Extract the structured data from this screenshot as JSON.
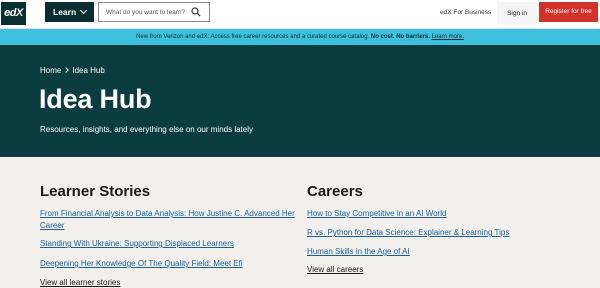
{
  "header": {
    "logo_text": "edX",
    "learn_label": "Learn",
    "search_placeholder": "What do you want to learn?",
    "business_label": "edX For Business",
    "signin_label": "Sign in",
    "register_label": "Register for free"
  },
  "banner": {
    "text": "New from Verizon and edX: Access free career resources and a curated course catalog.",
    "bold_text": "No cost. No barriers.",
    "link_text": "Learn more."
  },
  "hero": {
    "breadcrumb_home": "Home",
    "breadcrumb_current": "Idea Hub",
    "title": "Idea Hub",
    "subtitle": "Resources, insights, and everything else on our minds lately"
  },
  "learner_stories": {
    "title": "Learner Stories",
    "items": [
      {
        "label": "From Financial Analysis to Data Analysis: How Justine C. Advanced Her Career"
      },
      {
        "label": "Standing With Ukraine: Supporting Displaced Learners"
      },
      {
        "label": "Deepening Her Knowledge Of The Quality Field: Meet Efi"
      }
    ],
    "view_all": "View all learner stories"
  },
  "careers": {
    "title": "Careers",
    "items": [
      {
        "label": "How to Stay Competitive in an AI World"
      },
      {
        "label": "R vs. Python for Data Science: Explainer & Learning Tips"
      },
      {
        "label": "Human Skills in the Age of AI"
      }
    ],
    "view_all": "View all careers"
  },
  "colors": {
    "header_bg": "#ffffff",
    "brand_dark": "#0b3c3f",
    "banner_bg": "#3ec0de",
    "register_red": "#d23228",
    "link_blue": "#1d5f96",
    "page_bg": "#f2f0ed"
  }
}
